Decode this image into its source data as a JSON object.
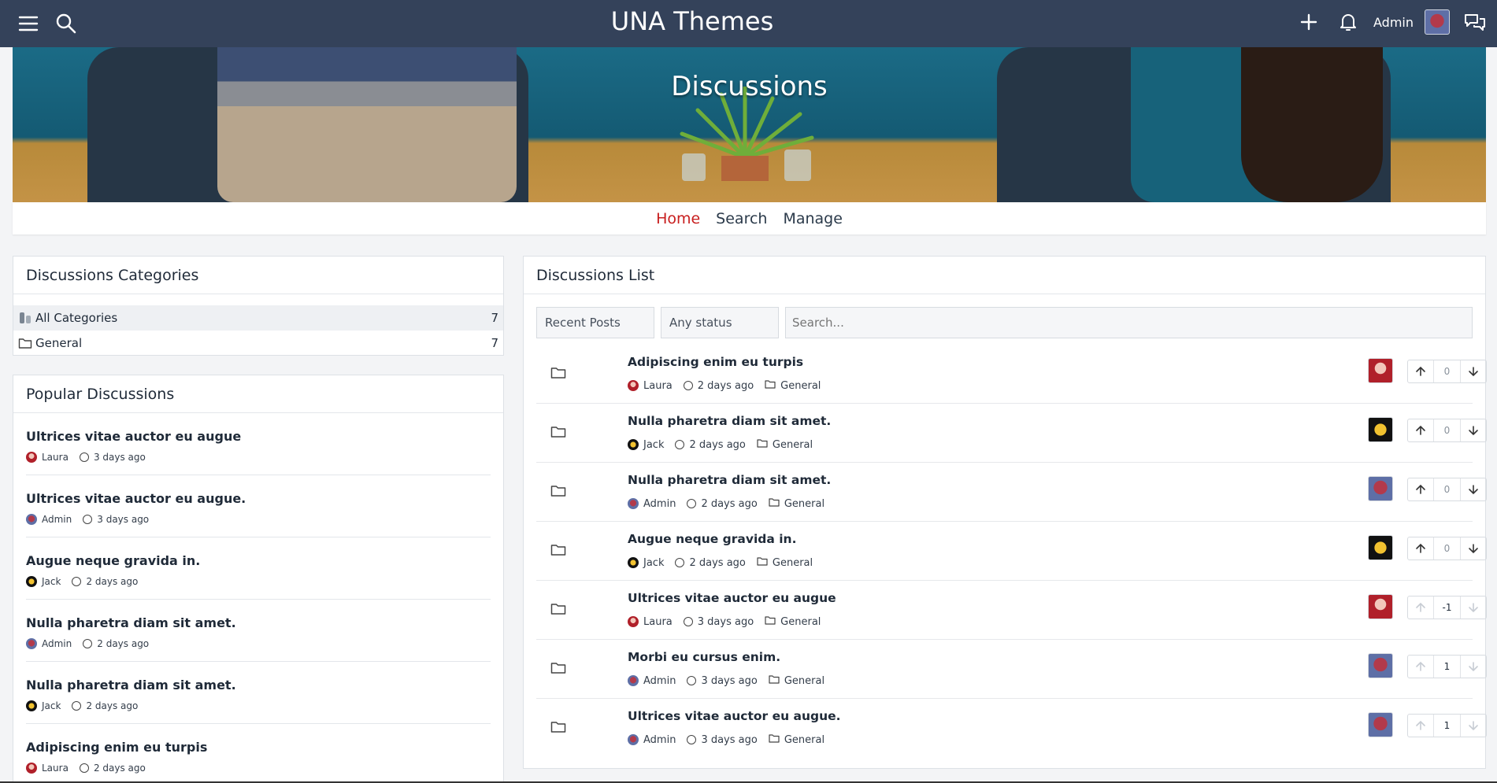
{
  "topbar": {
    "title": "UNA Themes",
    "user": "Admin",
    "icons": [
      "menu-icon",
      "search-icon",
      "plus-icon",
      "bell-icon",
      "chat-icon"
    ]
  },
  "cover": {
    "title": "Discussions"
  },
  "submenu": {
    "items": [
      "Home",
      "Search",
      "Manage"
    ],
    "active": "Home"
  },
  "categories": {
    "heading": "Discussions Categories",
    "items": [
      {
        "label": "All Categories",
        "count": "7"
      },
      {
        "label": "General",
        "count": "7"
      }
    ]
  },
  "popular": {
    "heading": "Popular Discussions",
    "items": [
      {
        "title": "Ultrices vitae auctor eu augue",
        "author": "Laura",
        "time": "3 days ago"
      },
      {
        "title": "Ultrices vitae auctor eu augue.",
        "author": "Admin",
        "time": "3 days ago"
      },
      {
        "title": "Augue neque gravida in.",
        "author": "Jack",
        "time": "2 days ago"
      },
      {
        "title": "Nulla pharetra diam sit amet.",
        "author": "Admin",
        "time": "2 days ago"
      },
      {
        "title": "Nulla pharetra diam sit amet.",
        "author": "Jack",
        "time": "2 days ago"
      },
      {
        "title": "Adipiscing enim eu turpis",
        "author": "Laura",
        "time": "2 days ago"
      }
    ]
  },
  "list": {
    "heading": "Discussions List",
    "filters": {
      "sort": "Recent Posts",
      "status": "Any status",
      "search_placeholder": "Search..."
    },
    "rows": [
      {
        "title": "Adipiscing enim eu turpis",
        "author": "Laura",
        "time": "2 days ago",
        "category": "General",
        "votes": "0",
        "voted": false
      },
      {
        "title": "Nulla pharetra diam sit amet.",
        "author": "Jack",
        "time": "2 days ago",
        "category": "General",
        "votes": "0",
        "voted": false
      },
      {
        "title": "Nulla pharetra diam sit amet.",
        "author": "Admin",
        "time": "2 days ago",
        "category": "General",
        "votes": "0",
        "voted": false
      },
      {
        "title": "Augue neque gravida in.",
        "author": "Jack",
        "time": "2 days ago",
        "category": "General",
        "votes": "0",
        "voted": false
      },
      {
        "title": "Ultrices vitae auctor eu augue",
        "author": "Laura",
        "time": "3 days ago",
        "category": "General",
        "votes": "-1",
        "voted": true
      },
      {
        "title": "Morbi eu cursus enim.",
        "author": "Admin",
        "time": "3 days ago",
        "category": "General",
        "votes": "1",
        "voted": true
      },
      {
        "title": "Ultrices vitae auctor eu augue.",
        "author": "Admin",
        "time": "3 days ago",
        "category": "General",
        "votes": "1",
        "voted": true
      }
    ]
  },
  "colors": {
    "topbar": "#34425a",
    "active_menu": "#c81e1e"
  }
}
